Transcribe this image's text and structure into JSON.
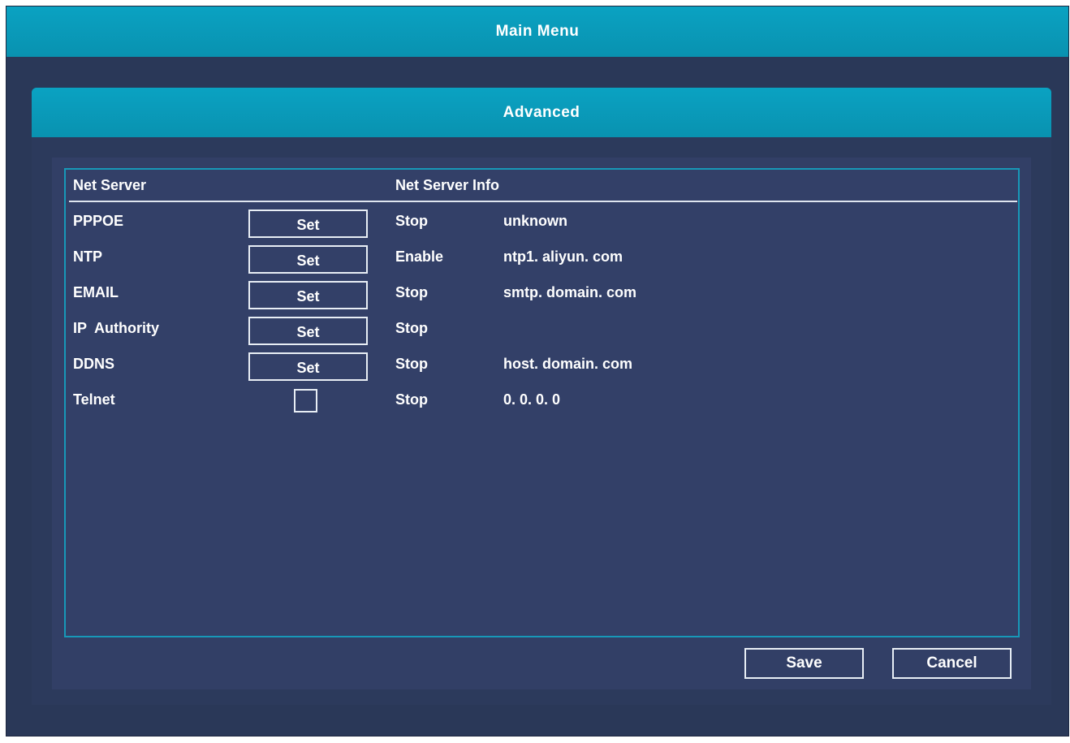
{
  "window": {
    "title": "Main Menu"
  },
  "dialog": {
    "title": "Advanced"
  },
  "table": {
    "headers": [
      "Net Server",
      "Net Server Info"
    ],
    "rows": [
      {
        "name": "PPPOE",
        "control": "button",
        "button_label": "Set",
        "status": "Stop",
        "info": "unknown"
      },
      {
        "name": "NTP",
        "control": "button",
        "button_label": "Set",
        "status": "Enable",
        "info": "ntp1. aliyun. com"
      },
      {
        "name": "EMAIL",
        "control": "button",
        "button_label": "Set",
        "status": "Stop",
        "info": "smtp. domain. com"
      },
      {
        "name": "IP  Authority",
        "control": "button",
        "button_label": "Set",
        "status": "Stop",
        "info": ""
      },
      {
        "name": "DDNS",
        "control": "button",
        "button_label": "Set",
        "status": "Stop",
        "info": "host. domain. com"
      },
      {
        "name": "Telnet",
        "control": "checkbox",
        "checked": false,
        "status": "Stop",
        "info": "0. 0. 0. 0"
      }
    ]
  },
  "buttons": {
    "save": "Save",
    "cancel": "Cancel"
  },
  "colors": {
    "header": "#0aa2c2",
    "background": "#2a3858",
    "panel": "#323f66",
    "frame_border": "#1798b8",
    "text": "#ffffff"
  }
}
